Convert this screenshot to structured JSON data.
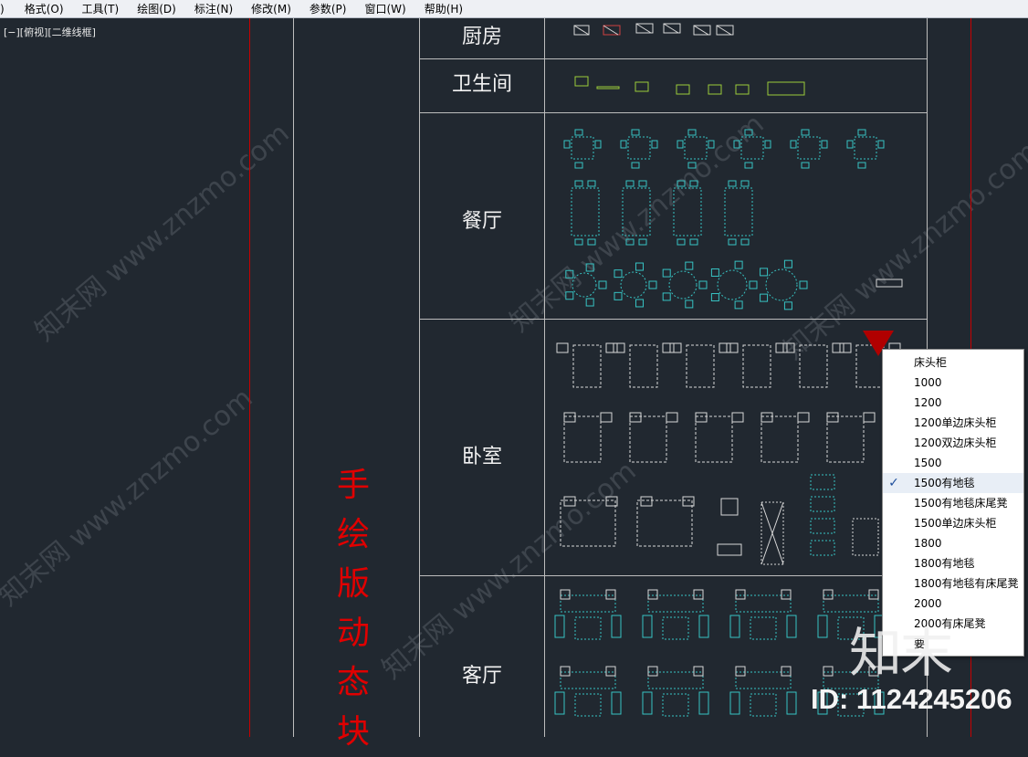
{
  "menubar": {
    "items": [
      ")",
      "格式(O)",
      "工具(T)",
      "绘图(D)",
      "标注(N)",
      "修改(M)",
      "参数(P)",
      "窗口(W)",
      "帮助(H)"
    ]
  },
  "viewport": {
    "label": "[−][俯视][二维线框]"
  },
  "vertical_title": [
    "手",
    "绘",
    "版",
    "动",
    "态",
    "块"
  ],
  "rows": [
    "厨房",
    "卫生间",
    "餐厅",
    "卧室",
    "客厅"
  ],
  "context_menu": {
    "items": [
      {
        "label": "床头柜",
        "checked": false
      },
      {
        "label": "1000",
        "checked": false
      },
      {
        "label": "1200",
        "checked": false
      },
      {
        "label": "1200单边床头柜",
        "checked": false
      },
      {
        "label": "1200双边床头柜",
        "checked": false
      },
      {
        "label": "1500",
        "checked": false
      },
      {
        "label": "1500有地毯",
        "checked": true
      },
      {
        "label": "1500有地毯床尾凳",
        "checked": false
      },
      {
        "label": "1500单边床头柜",
        "checked": false
      },
      {
        "label": "1800",
        "checked": false
      },
      {
        "label": "1800有地毯",
        "checked": false
      },
      {
        "label": "1800有地毯有床尾凳",
        "checked": false
      },
      {
        "label": "2000",
        "checked": false
      },
      {
        "label": "2000有床尾凳",
        "checked": false
      },
      {
        "label": "要"
      }
    ]
  },
  "watermarks": [
    "知末网 www.znzmo.com"
  ],
  "brand": "知末",
  "id_label": "ID: 1124245206",
  "colors": {
    "background": "#212830",
    "cad_cyan": "#37c3c3",
    "cad_green": "#9ccc3a",
    "cad_red": "#c80000",
    "title_red": "#e00000"
  }
}
